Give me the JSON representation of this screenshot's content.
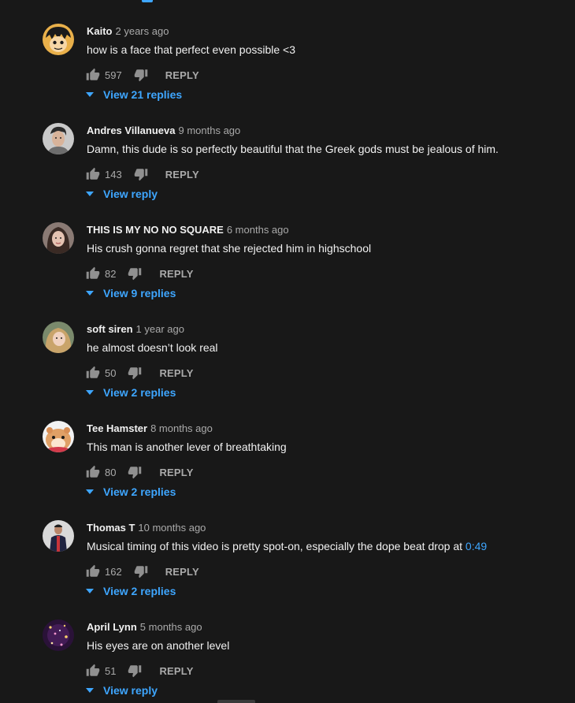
{
  "comments": [
    {
      "author": "Kaito",
      "time": "2 years ago",
      "text": "how is a face that perfect even possible <3",
      "likes": "597",
      "reply_label": "REPLY",
      "view_replies": "View 21 replies",
      "avatar_icon": "anime-character-avatar"
    },
    {
      "author": "Andres Villanueva",
      "time": "9 months ago",
      "text": "Damn, this dude is so perfectly beautiful that the Greek gods must be jealous of him.",
      "likes": "143",
      "reply_label": "REPLY",
      "view_replies": "View reply",
      "avatar_icon": "man-portrait-avatar"
    },
    {
      "author": "THIS IS MY NO NO SQUARE",
      "time": "6 months ago",
      "text": "His crush gonna regret that she rejected him in highschool",
      "likes": "82",
      "reply_label": "REPLY",
      "view_replies": "View 9 replies",
      "avatar_icon": "woman-portrait-avatar"
    },
    {
      "author": "soft siren",
      "time": "1 year ago",
      "text": "he almost doesn’t look real",
      "likes": "50",
      "reply_label": "REPLY",
      "view_replies": "View 2 replies",
      "avatar_icon": "woman-portrait-avatar"
    },
    {
      "author": "Tee Hamster",
      "time": "8 months ago",
      "text": "This man is another lever of breathtaking",
      "likes": "80",
      "reply_label": "REPLY",
      "view_replies": "View 2 replies",
      "avatar_icon": "hamster-avatar"
    },
    {
      "author": "Thomas T",
      "time": "10 months ago",
      "text": "Musical timing of this video is pretty spot-on, especially the dope beat drop at ",
      "timestamp_link": "0:49",
      "likes": "162",
      "reply_label": "REPLY",
      "view_replies": "View 2 replies",
      "avatar_icon": "man-in-jacket-avatar"
    },
    {
      "author": "April Lynn",
      "time": "5 months ago",
      "text": "His eyes are on another level",
      "likes": "51",
      "reply_label": "REPLY",
      "view_replies": "View reply",
      "avatar_icon": "galaxy-avatar"
    }
  ],
  "colors": {
    "background": "#181818",
    "text_primary": "#f1f1f1",
    "text_secondary": "#aaaaaa",
    "link": "#3ea6ff"
  }
}
